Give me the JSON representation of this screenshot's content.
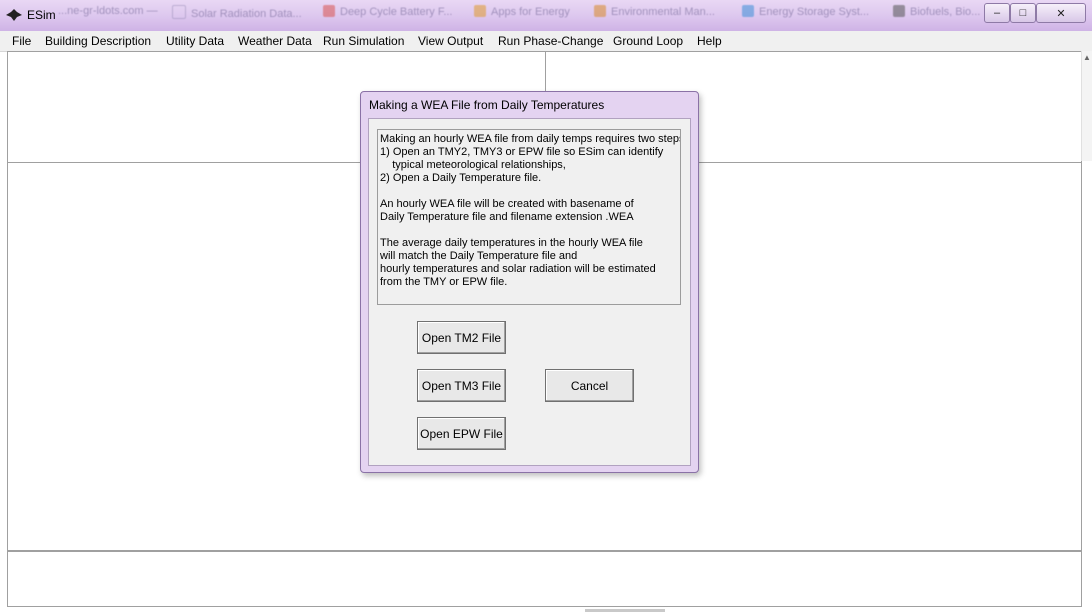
{
  "window": {
    "title": "ESim",
    "background_tabs": [
      "...ne-gr-ldots.com —",
      "Solar Radiation Data...",
      "Deep Cycle Battery F...",
      "Apps for Energy",
      "Environmental Man...",
      "Energy Storage Syst...",
      "Biofuels, Bio..."
    ],
    "minimize": "–",
    "maximize": "□",
    "close": "✕"
  },
  "menu": [
    "File",
    "Building Description",
    "Utility Data",
    "Weather Data",
    "Run Simulation",
    "View Output",
    "Run Phase-Change",
    "Ground Loop",
    "Help"
  ],
  "dialog": {
    "title": "Making a WEA File from Daily Temperatures",
    "info_text": "Making an hourly WEA file from daily temps requires two steps:\n1) Open an TMY2, TMY3 or EPW file so ESim can identify\n    typical meteorological relationships,\n2) Open a Daily Temperature file.\n\nAn hourly WEA file will be created with basename of\nDaily Temperature file and filename extension .WEA\n\nThe average daily temperatures in the hourly WEA file\nwill match the Daily Temperature file and\nhourly temperatures and solar radiation will be estimated\nfrom the TMY or EPW file.",
    "buttons": {
      "open_tm2": "Open TM2 File",
      "open_tm3": "Open TM3 File",
      "open_epw": "Open EPW File",
      "cancel": "Cancel"
    }
  },
  "colors": {
    "titlebar": "#dcc6ee",
    "dialog_frame": "#e4d3f1",
    "face": "#f0f0f0"
  }
}
